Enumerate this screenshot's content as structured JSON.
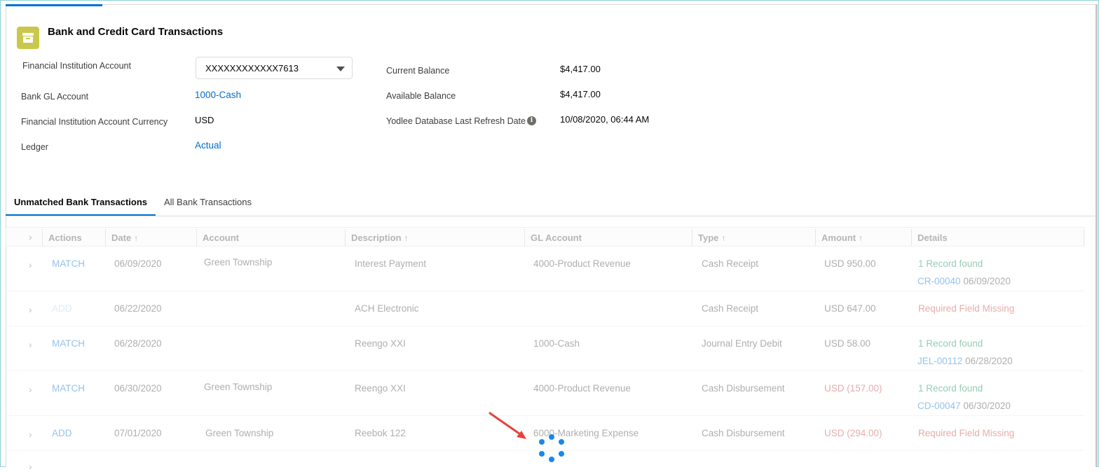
{
  "header": {
    "title": "Bank and Credit Card Transactions",
    "icon": "bank-transactions-icon",
    "icon_color": "#c9c84c"
  },
  "fields": {
    "financial_institution_account": {
      "label": "Financial Institution Account",
      "value": "XXXXXXXXXXXX7613"
    },
    "bank_gl_account": {
      "label": "Bank GL Account",
      "value": "1000-Cash"
    },
    "currency": {
      "label": "Financial Institution Account Currency",
      "value": "USD"
    },
    "ledger": {
      "label": "Ledger",
      "value": "Actual"
    },
    "current_balance": {
      "label": "Current Balance",
      "value": "$4,417.00"
    },
    "available_balance": {
      "label": "Available Balance",
      "value": "$4,417.00"
    },
    "refresh_date": {
      "label": "Yodlee Database Last Refresh Date",
      "value": "10/08/2020, 06:44 AM"
    }
  },
  "tabs": [
    {
      "label": "Unmatched Bank Transactions",
      "active": true
    },
    {
      "label": "All Bank Transactions",
      "active": false
    }
  ],
  "table": {
    "columns": [
      "Actions",
      "Date",
      "Account",
      "Description",
      "GL Account",
      "Type",
      "Amount",
      "Details"
    ],
    "sort_arrow": "↑",
    "rows": [
      {
        "action": "MATCH",
        "date": "06/09/2020",
        "account": "Green Township",
        "description": "Interest Payment",
        "gl_account": "4000-Product Revenue",
        "type": "Cash Receipt",
        "amount": "USD 950.00",
        "detail": "1 Record found",
        "detail_link": "CR-00040",
        "detail_date": "06/09/2020"
      },
      {
        "action": "ADD",
        "date": "06/22/2020",
        "account": "",
        "description": "ACH Electronic",
        "gl_account": "",
        "type": "Cash Receipt",
        "amount": "USD 647.00",
        "detail": "Required Field Missing",
        "detail_link": "",
        "detail_date": ""
      },
      {
        "action": "MATCH",
        "date": "06/28/2020",
        "account": "",
        "description": "Reengo XXI",
        "gl_account": "1000-Cash",
        "type": "Journal Entry Debit",
        "amount": "USD 58.00",
        "detail": "1 Record found",
        "detail_link": "JEL-00112",
        "detail_date": "06/28/2020"
      },
      {
        "action": "MATCH",
        "date": "06/30/2020",
        "account": "Green Township",
        "description": "Reengo XXI",
        "gl_account": "4000-Product Revenue",
        "type": "Cash Disbursement",
        "amount": "USD (157.00)",
        "detail": "1 Record found",
        "detail_link": "CD-00047",
        "detail_date": "06/30/2020"
      },
      {
        "action": "ADD",
        "date": "07/01/2020",
        "account": "Green Township",
        "description": "Reebok 122",
        "gl_account": "6000-Marketing Expense",
        "type": "Cash Disbursement",
        "amount": "USD (294.00)",
        "detail": "Required Field Missing",
        "detail_link": "",
        "detail_date": ""
      }
    ]
  }
}
